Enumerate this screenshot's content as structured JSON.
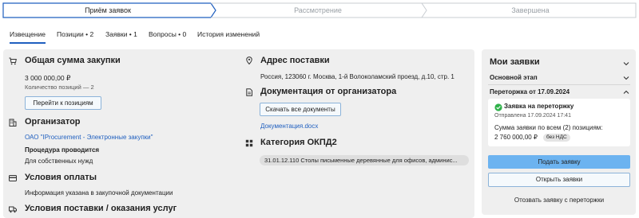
{
  "stepper": {
    "steps": [
      "Приём заявок",
      "Рассмотрение",
      "Завершена"
    ]
  },
  "tabs": [
    "Извещение",
    "Позиции • 2",
    "Заявки • 1",
    "Вопросы • 0",
    "История изменений"
  ],
  "main": {
    "total": {
      "title": "Общая сумма закупки",
      "amount": "3 000 000,00 ₽",
      "positions_count": "Количество позиций — 2",
      "goto_button": "Перейти к позициям"
    },
    "organizer": {
      "title": "Организатор",
      "link": "ОАО \"IProcurement - Электронные закупки\"",
      "procedure_label": "Процедура проводится",
      "procedure_value": "Для собственных нужд"
    },
    "payment": {
      "title": "Условия оплаты",
      "text": "Информация указана в закупочной документации"
    },
    "delivery_terms": {
      "title": "Условия поставки / оказания услуг"
    },
    "address": {
      "title": "Адрес поставки",
      "text": "Россия, 123060 г. Москва, 1-й Волоколамский проезд, д.10, стр. 1"
    },
    "docs": {
      "title": "Документация от организатора",
      "download_button": "Скачать все документы",
      "file": "Документация.docx"
    },
    "okpd": {
      "title": "Категория ОКПД2",
      "chip": "31.01.12.110 Столы письменные деревянные для офисов, админис..."
    }
  },
  "side": {
    "title": "Мои заявки",
    "main_stage": "Основной этап",
    "retrade": "Переторжка от 17.09.2024",
    "card": {
      "status": "Заявка на переторжку",
      "sent": "Отправлена 17.09.2024 17:41",
      "sum_label": "Сумма заявки по всем (2) позициям:",
      "sum_value": "2 760 000,00 ₽",
      "vat_badge": "без НДС"
    },
    "submit_button": "Подать заявку",
    "open_button": "Открыть заявки",
    "withdraw_button": "Отозвать заявку с переторжки"
  },
  "colors": {
    "accent": "#1f5fbf",
    "primary_button": "#6cb3f0",
    "success": "#2fb14a",
    "panel_bg": "#efefef"
  }
}
